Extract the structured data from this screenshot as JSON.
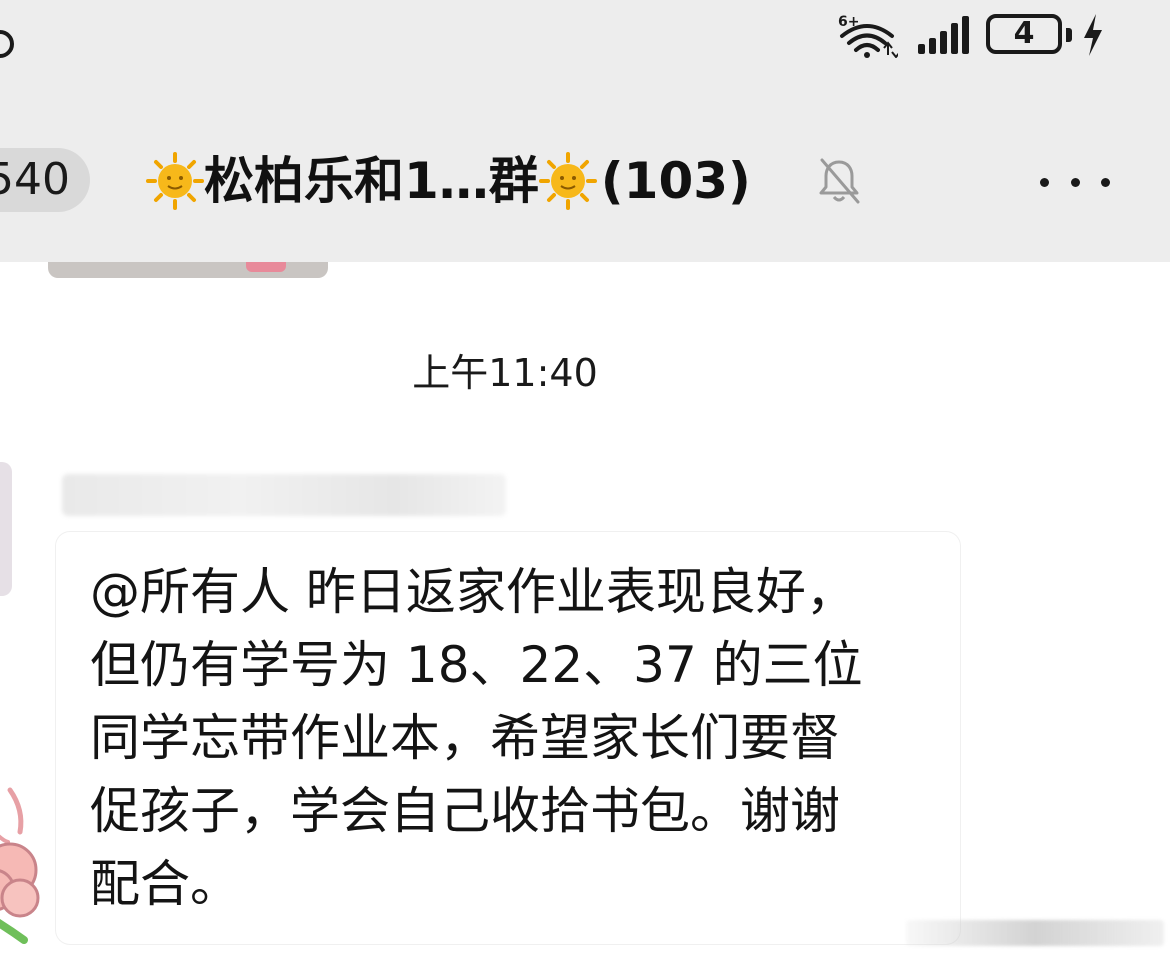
{
  "status_bar": {
    "battery_level": "4",
    "network_label": "6+",
    "icons": [
      "wifi-icon",
      "signal-icon",
      "battery-icon",
      "charging-icon"
    ]
  },
  "header": {
    "back_count": "540",
    "title_prefix_emoji": "sun-face-icon",
    "title": "松柏乐和1…群",
    "title_suffix_emoji": "sun-face-icon",
    "member_count": "(103)",
    "muted_icon": "bell-muted-icon",
    "more_icon": "more-icon"
  },
  "chat": {
    "timestamp": "上午11:40",
    "message": {
      "text": "@所有人  昨日返家作业表现良好，\n但仍有学号为 18、22、37 的三位\n同学忘带作业本，希望家长们要督\n促孩子，学会自己收拾书包。谢谢\n配合。"
    }
  },
  "colors": {
    "bar_background": "#ededed",
    "chat_background": "#ffffff",
    "bubble_background": "#ffffff",
    "badge_background": "#d9d9d9",
    "sun_yellow": "#f7b81a"
  }
}
